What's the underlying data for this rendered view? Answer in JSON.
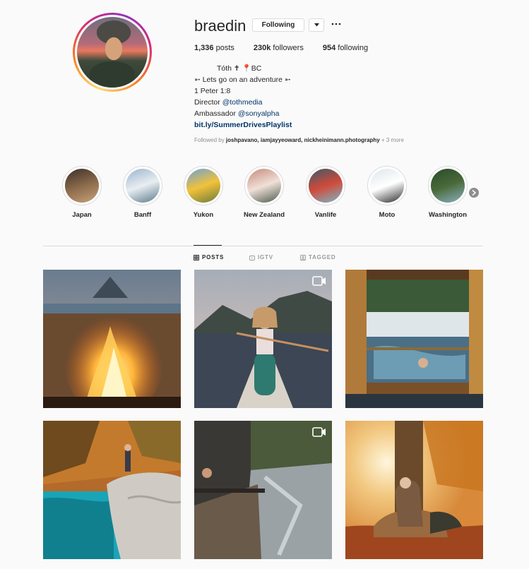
{
  "profile": {
    "username": "braedin",
    "follow_label": "Following",
    "stats": {
      "posts_count": "1,336",
      "posts_label": " posts",
      "followers_count": "230k",
      "followers_label": " followers",
      "following_count": "954",
      "following_label": " following"
    },
    "bio": {
      "line1": "Tóth ✝ 📍BC",
      "line2": "➵ Lets go on an adventure ➵",
      "line3": "1 Peter 1:8",
      "line4_prefix": "Director ",
      "line4_link": "@tothmedia",
      "line5_prefix": "Ambassador ",
      "line5_link": "@sonyalpha",
      "url": "bit.ly/SummerDrivesPlaylist"
    },
    "followed_by": {
      "prefix": "Followed by ",
      "names": "joshpavano, iamjayyeoward, nickheinimann.photography",
      "suffix": " + 3 more"
    }
  },
  "highlights": [
    {
      "label": "Japan",
      "colors": [
        "#3a2f2a",
        "#8a6a4a",
        "#c9a27a"
      ]
    },
    {
      "label": "Banff",
      "colors": [
        "#9bb4cc",
        "#e9eef2",
        "#5a7a8a"
      ]
    },
    {
      "label": "Yukon",
      "colors": [
        "#6aa0d8",
        "#f2c23a",
        "#6b7a3a"
      ]
    },
    {
      "label": "New Zealand",
      "colors": [
        "#c48a7a",
        "#f0e0d8",
        "#4a5a4a"
      ]
    },
    {
      "label": "Vanlife",
      "colors": [
        "#3a5a6a",
        "#d04a3a",
        "#7ab8c8"
      ]
    },
    {
      "label": "Moto",
      "colors": [
        "#dfe6ea",
        "#ffffff",
        "#2a2a2a"
      ]
    },
    {
      "label": "Washington",
      "colors": [
        "#2a4a2a",
        "#4a6a3a",
        "#8ab0c0"
      ]
    }
  ],
  "tabs": [
    {
      "label": "POSTS",
      "icon": "grid-icon",
      "active": true
    },
    {
      "label": "IGTV",
      "icon": "igtv-icon",
      "active": false
    },
    {
      "label": "TAGGED",
      "icon": "tagged-icon",
      "active": false
    }
  ],
  "posts": [
    {
      "name": "post-campfire",
      "video": false
    },
    {
      "name": "post-canoe",
      "video": true
    },
    {
      "name": "post-hot-spring",
      "video": false
    },
    {
      "name": "post-turquoise-river",
      "video": false
    },
    {
      "name": "post-onsen-river",
      "video": true
    },
    {
      "name": "post-deer-autumn",
      "video": false
    }
  ],
  "colors": {
    "text": "#262626",
    "muted": "#8e8e8e",
    "link": "#003569",
    "border": "#dbdbdb",
    "background": "#fafafa"
  }
}
